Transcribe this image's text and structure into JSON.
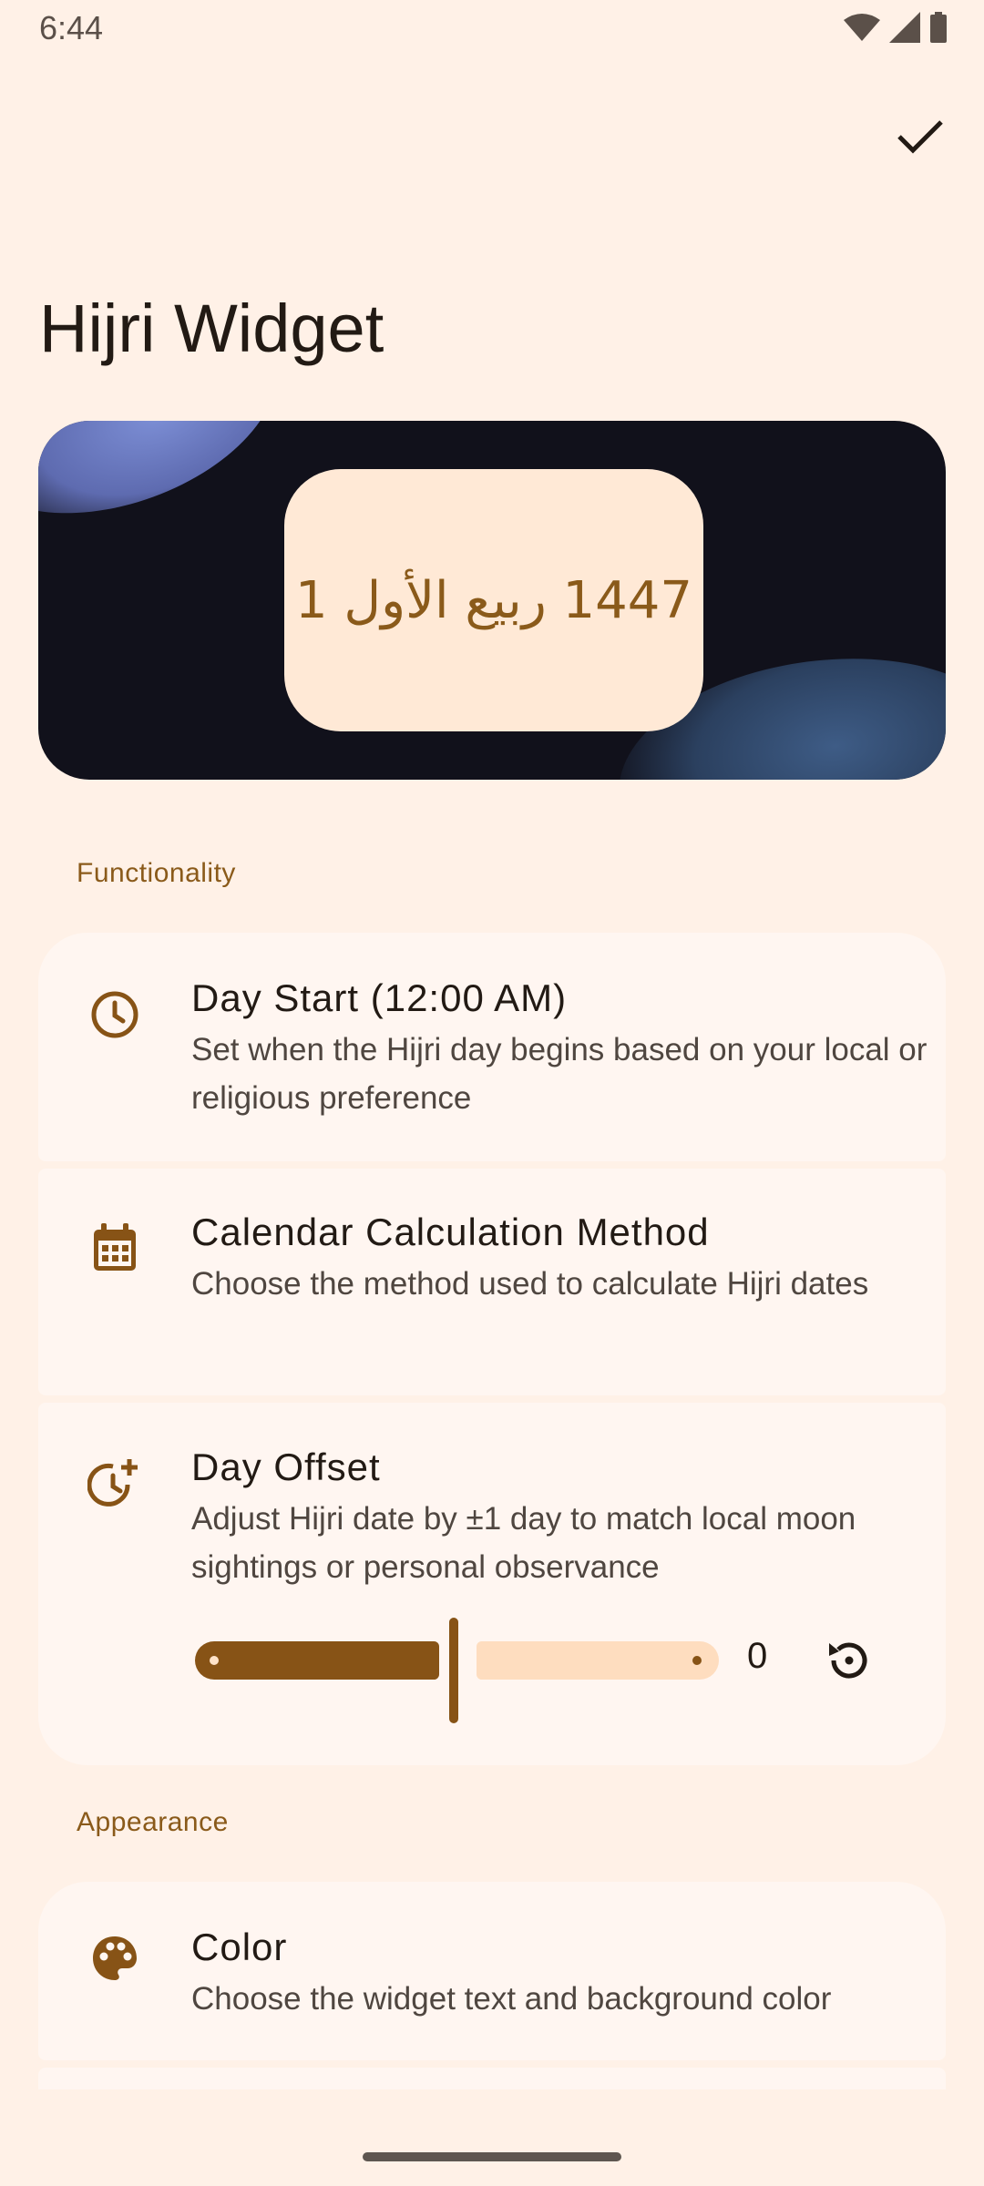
{
  "status_bar": {
    "time": "6:44",
    "icons": [
      "wifi-icon",
      "signal-icon",
      "battery-icon"
    ]
  },
  "toolbar": {
    "done_icon": "check-icon"
  },
  "page": {
    "title": "Hijri Widget"
  },
  "preview": {
    "widget_date": "1447 ربيع الأول 1"
  },
  "sections": {
    "functionality": "Functionality",
    "appearance": "Appearance"
  },
  "settings": {
    "day_start": {
      "icon": "clock-icon",
      "title": "Day Start (12:00 AM)",
      "subtitle": "Set when the Hijri day begins based on your local or religious preference"
    },
    "calendar_method": {
      "icon": "calendar-icon",
      "title": "Calendar Calculation Method",
      "subtitle": "Choose the method used to calculate Hijri dates"
    },
    "day_offset": {
      "icon": "clock-plus-icon",
      "title": "Day Offset",
      "subtitle": "Adjust Hijri date by ±1 day to match local moon sightings or personal observance",
      "slider": {
        "min": -1,
        "max": 1,
        "value": 0
      },
      "value_label": "0",
      "reset_icon": "reset-icon"
    },
    "color": {
      "icon": "palette-icon",
      "title": "Color",
      "subtitle": "Choose the widget text and background color"
    }
  },
  "colors": {
    "background": "#FFF1E7",
    "card": "#FFF6F1",
    "accent": "#875316",
    "slider_inactive": "#FEDDBF",
    "widget_bg": "#FFE9D6"
  }
}
